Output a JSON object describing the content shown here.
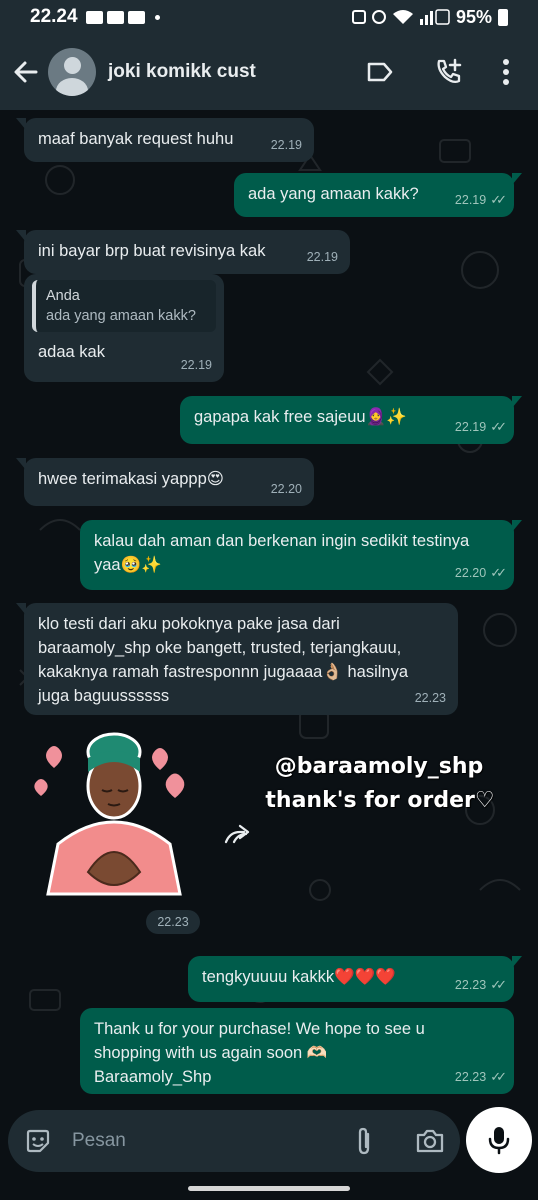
{
  "status_bar": {
    "time": "22.24",
    "battery": "95%"
  },
  "header": {
    "contact_name": "joki komikk cust"
  },
  "messages": [
    {
      "dir": "in",
      "text": "maaf banyak request huhu",
      "time": "22.19"
    },
    {
      "dir": "out",
      "text": "ada yang amaan kakk?",
      "time": "22.19"
    },
    {
      "dir": "in",
      "text": "ini bayar brp buat revisinya kak",
      "time": "22.19"
    },
    {
      "dir": "in",
      "quote_author": "Anda",
      "quote_text": "ada yang amaan kakk?",
      "text": "adaa kak",
      "time": "22.19"
    },
    {
      "dir": "out",
      "text": "gapapa kak free sajeuu🧕✨",
      "time": "22.19"
    },
    {
      "dir": "in",
      "text": "hwee terimakasi yappp😍",
      "time": "22.20"
    },
    {
      "dir": "out",
      "text": "kalau dah aman dan berkenan ingin sedikit testinya yaa🥹✨",
      "time": "22.20"
    },
    {
      "dir": "in",
      "text": "klo testi dari aku pokoknya pake jasa dari baraamoly_shp oke bangett, trusted, terjangkauu, kakaknya ramah fastresponnn jugaaaa👌🏼 hasilnya juga baguussssss",
      "time": "22.23"
    },
    {
      "dir": "out",
      "text": "tengkyuuuu kakkk❤️❤️❤️",
      "time": "22.23"
    },
    {
      "dir": "out",
      "text": "Thank u for your purchase! We hope to see u shopping with us again soon 🫶🏻 Baraamoly_Shp",
      "time": "22.23"
    }
  ],
  "sticker": {
    "time": "22.23"
  },
  "overlay": {
    "line1": "@baraamoly_shp",
    "line2": "thank's for order♡"
  },
  "composer": {
    "placeholder": "Pesan"
  },
  "colors": {
    "incoming": "#1f2c33",
    "outgoing": "#005c4b",
    "background": "#0b1014",
    "accent": "#00a884"
  }
}
